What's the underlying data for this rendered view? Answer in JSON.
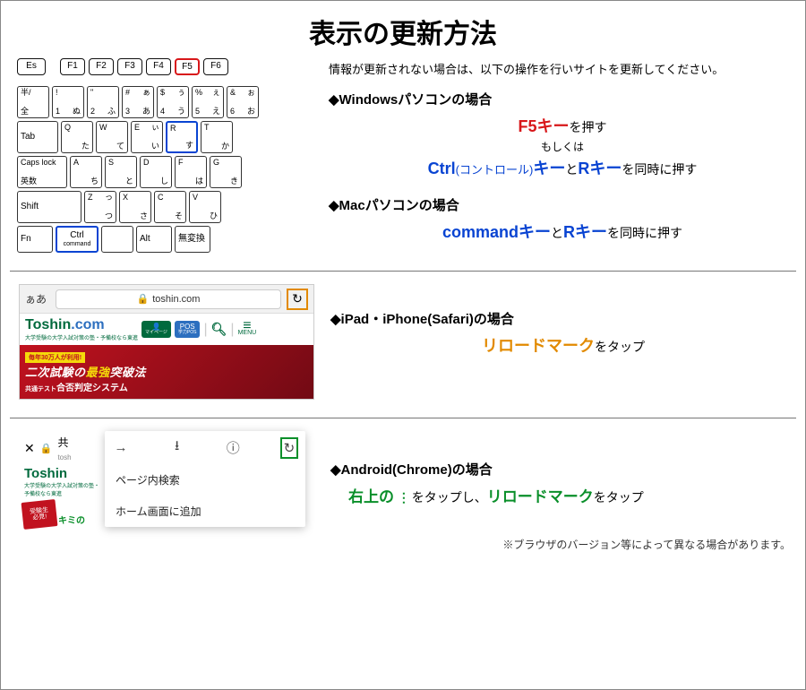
{
  "title": "表示の更新方法",
  "intro": "情報が更新されない場合は、以下の操作を行いサイトを更新してください。",
  "keyboard": {
    "frow": [
      "Es",
      "F1",
      "F2",
      "F3",
      "F4",
      "F5",
      "F6"
    ],
    "r1": [
      {
        "tl": "半/",
        "tr": "",
        "bl": "全",
        "br": ""
      },
      {
        "tl": "!",
        "tr": "",
        "bl": "1",
        "br": "ぬ"
      },
      {
        "tl": "\"",
        "tr": "",
        "bl": "2",
        "br": "ふ"
      },
      {
        "tl": "#",
        "tr": "ぁ",
        "bl": "3",
        "br": "あ"
      },
      {
        "tl": "$",
        "tr": "ぅ",
        "bl": "4",
        "br": "う"
      },
      {
        "tl": "%",
        "tr": "ぇ",
        "bl": "5",
        "br": "え"
      },
      {
        "tl": "&",
        "tr": "ぉ",
        "bl": "6",
        "br": "お"
      }
    ],
    "r2": {
      "tab": "Tab",
      "keys": [
        {
          "tl": "Q",
          "bl": "",
          "br": "た"
        },
        {
          "tl": "W",
          "bl": "",
          "br": "て"
        },
        {
          "tl": "E",
          "tr": "ぃ",
          "bl": "",
          "br": "い"
        },
        {
          "tl": "R",
          "bl": "",
          "br": "す"
        },
        {
          "tl": "T",
          "bl": "",
          "br": "か"
        }
      ]
    },
    "r3": {
      "caps": "Caps lock",
      "caps2": "英数",
      "keys": [
        {
          "tl": "A",
          "br": "ち"
        },
        {
          "tl": "S",
          "br": "と"
        },
        {
          "tl": "D",
          "br": "し"
        },
        {
          "tl": "F",
          "br": "は"
        },
        {
          "tl": "G",
          "br": "き"
        }
      ]
    },
    "r4": {
      "shift": "Shift",
      "keys": [
        {
          "tl": "Z",
          "tr": "っ",
          "br": "つ"
        },
        {
          "tl": "X",
          "br": "さ"
        },
        {
          "tl": "C",
          "br": "そ"
        },
        {
          "tl": "V",
          "br": "ひ"
        }
      ]
    },
    "r5": {
      "fn": "Fn",
      "ctrl": "Ctrl",
      "cmd": "command",
      "alt": "Alt",
      "mu": "無変換"
    }
  },
  "windows": {
    "hd": "◆Windowsパソコンの場合",
    "l1a": "F5キー",
    "l1b": "を押す",
    "l2": "もしくは",
    "l3a": "Ctrl",
    "l3b": "(コントロール)",
    "l3c": "キー",
    "l3d": "と",
    "l3e": "Rキー",
    "l3f": "を同時に押す"
  },
  "mac": {
    "hd": "◆Macパソコンの場合",
    "l1a": "commandキー",
    "l1b": "と",
    "l1c": "Rキー",
    "l1d": "を同時に押す"
  },
  "safari": {
    "hd": "◆iPad・iPhone(Safari)の場合",
    "l1a": "リロードマーク",
    "l1b": "をタップ",
    "aa": "ぁあ",
    "addr": "toshin.com",
    "reload": "↻",
    "logoT": "Toshin",
    "logoC": ".com",
    "sub": "大学受験の大学入試対策の塾・予備校なら東進",
    "badge1": "マイページ",
    "badge2a": "POS",
    "badge2b": "学力POS",
    "menu": "MENU",
    "bnTag": "毎年30万人が利用!",
    "bn1a": "二次試験の",
    "bn1b": "最強",
    "bn1c": "突破法",
    "bn2a": "共通テスト",
    "bn2b": "合否判定システム"
  },
  "chrome": {
    "hd": "◆Android(Chrome)の場合",
    "l1a": "右上の",
    "l1b": "⋮",
    "l1c": "をタップし、",
    "l1d": "リロードマーク",
    "l1e": "をタップ",
    "tab": "共",
    "tabSub": "tosh",
    "logo": "Toshin",
    "sub": "大学受験の大学入試対策の塾・予備校なら東進",
    "stamp1": "受験生",
    "stamp2": "必見!",
    "kimi": "キミの",
    "ov": {
      "back": "→",
      "dl": "⭳",
      "info": "ⓘ",
      "reload": "↻",
      "item1": "ページ内検索",
      "item2": "ホーム画面に追加"
    }
  },
  "note": "※ブラウザのバージョン等によって異なる場合があります。"
}
